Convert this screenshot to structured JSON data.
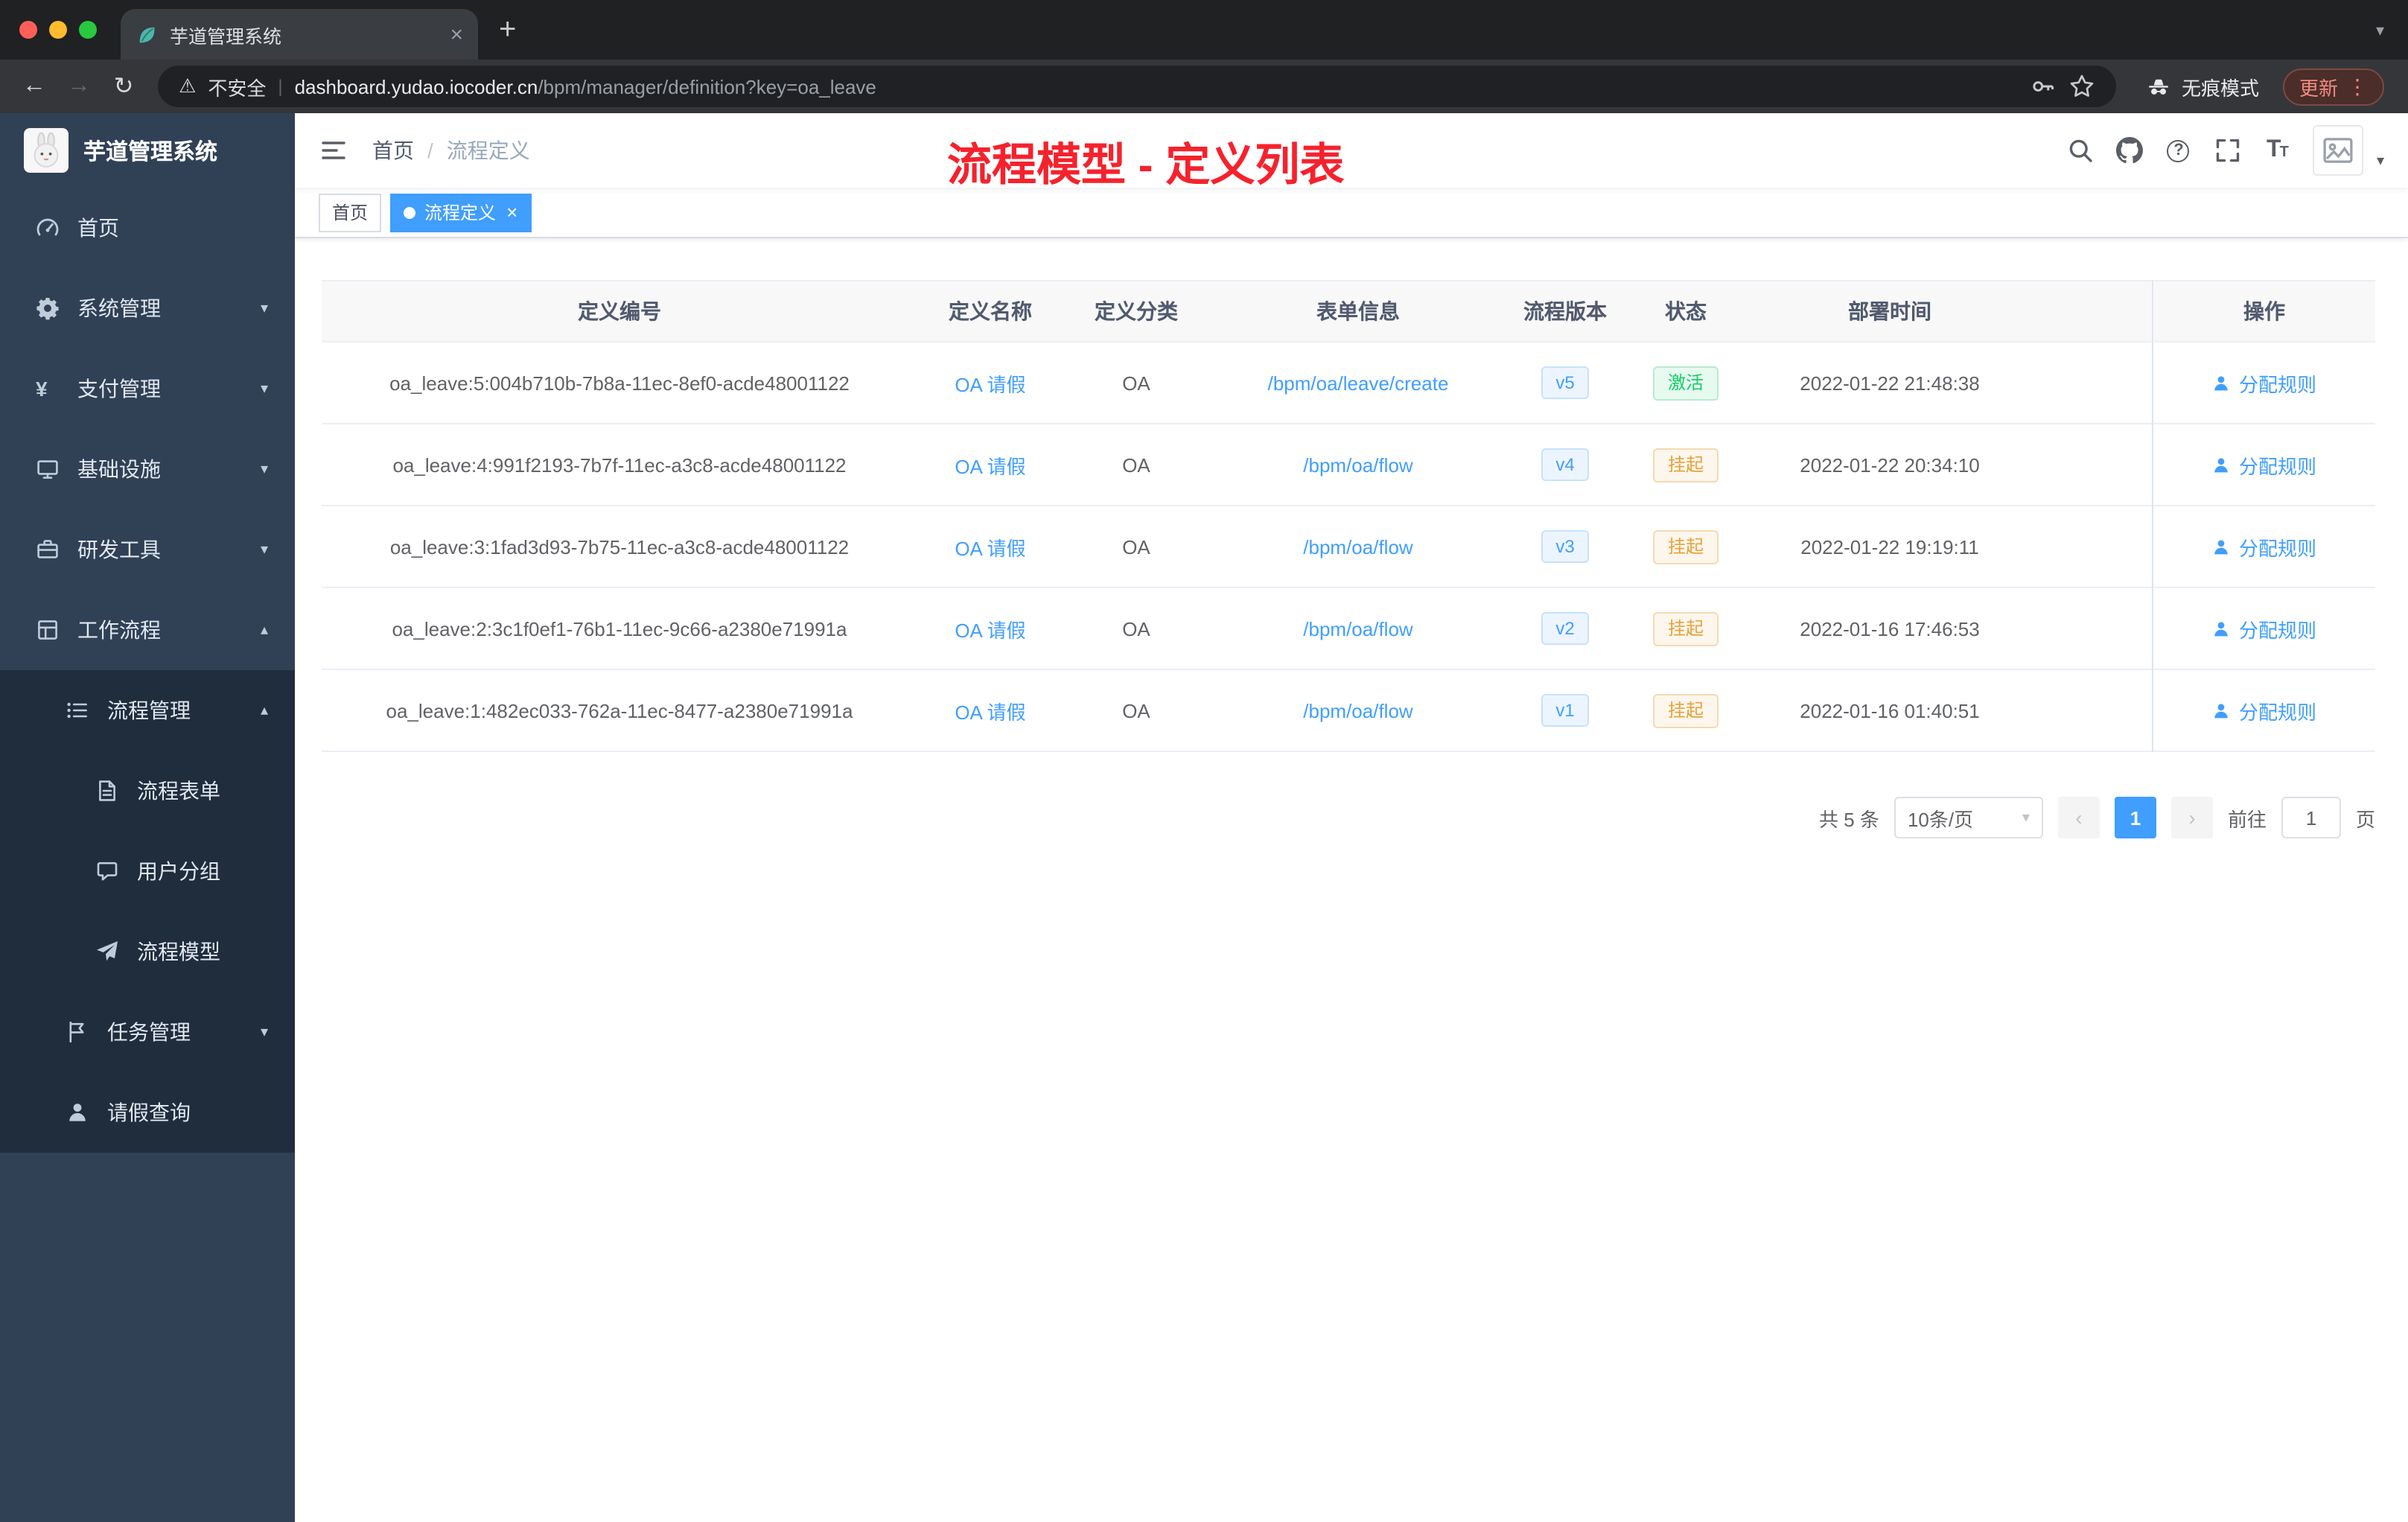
{
  "browser": {
    "tab_title": "芋道管理系统",
    "security_label": "不安全",
    "url_domain": "dashboard.yudao.iocoder.cn",
    "url_path": "/bpm/manager/definition?key=oa_leave",
    "incognito_label": "无痕模式",
    "update_label": "更新"
  },
  "sidebar": {
    "logo_title": "芋道管理系统",
    "menu": [
      {
        "key": "home",
        "label": "首页",
        "icon": "gauge-icon",
        "level": 0,
        "arrow": null,
        "dark": false
      },
      {
        "key": "system-management",
        "label": "系统管理",
        "icon": "gear-icon",
        "level": 0,
        "arrow": "down",
        "dark": false
      },
      {
        "key": "payment-management",
        "label": "支付管理",
        "icon": "yen-icon",
        "level": 0,
        "arrow": "down",
        "dark": false
      },
      {
        "key": "infrastructure",
        "label": "基础设施",
        "icon": "monitor-icon",
        "level": 0,
        "arrow": "down",
        "dark": false
      },
      {
        "key": "dev-tools",
        "label": "研发工具",
        "icon": "toolbox-icon",
        "level": 0,
        "arrow": "down",
        "dark": false
      },
      {
        "key": "workflow",
        "label": "工作流程",
        "icon": "grid-icon",
        "level": 0,
        "arrow": "up",
        "dark": false
      },
      {
        "key": "process-management",
        "label": "流程管理",
        "icon": "list-icon",
        "level": 1,
        "arrow": "up",
        "dark": true
      },
      {
        "key": "process-form",
        "label": "流程表单",
        "icon": "document-icon",
        "level": 2,
        "arrow": null,
        "dark": true
      },
      {
        "key": "user-group",
        "label": "用户分组",
        "icon": "chat-icon",
        "level": 2,
        "arrow": null,
        "dark": true
      },
      {
        "key": "process-model",
        "label": "流程模型",
        "icon": "plane-icon",
        "level": 2,
        "arrow": null,
        "dark": true
      },
      {
        "key": "task-management",
        "label": "任务管理",
        "icon": "flag-icon",
        "level": 1,
        "arrow": "down",
        "dark": true
      },
      {
        "key": "leave-query",
        "label": "请假查询",
        "icon": "person-icon",
        "level": 1,
        "arrow": null,
        "dark": true
      }
    ]
  },
  "header": {
    "breadcrumb": [
      "首页",
      "流程定义"
    ],
    "annotation": "流程模型 - 定义列表"
  },
  "tags": [
    {
      "key": "home",
      "label": "首页",
      "active": false,
      "closable": false
    },
    {
      "key": "process-definition",
      "label": "流程定义",
      "active": true,
      "closable": true
    }
  ],
  "table": {
    "columns": [
      "定义编号",
      "定义名称",
      "定义分类",
      "表单信息",
      "流程版本",
      "状态",
      "部署时间",
      "操作"
    ],
    "rows": [
      {
        "id": "oa_leave:5:004b710b-7b8a-11ec-8ef0-acde48001122",
        "name": "OA 请假",
        "category": "OA",
        "form": "/bpm/oa/leave/create",
        "version": "v5",
        "status": "激活",
        "status_type": "success",
        "deploy_time": "2022-01-22 21:48:38",
        "action": "分配规则"
      },
      {
        "id": "oa_leave:4:991f2193-7b7f-11ec-a3c8-acde48001122",
        "name": "OA 请假",
        "category": "OA",
        "form": "/bpm/oa/flow",
        "version": "v4",
        "status": "挂起",
        "status_type": "warning",
        "deploy_time": "2022-01-22 20:34:10",
        "action": "分配规则"
      },
      {
        "id": "oa_leave:3:1fad3d93-7b75-11ec-a3c8-acde48001122",
        "name": "OA 请假",
        "category": "OA",
        "form": "/bpm/oa/flow",
        "version": "v3",
        "status": "挂起",
        "status_type": "warning",
        "deploy_time": "2022-01-22 19:19:11",
        "action": "分配规则"
      },
      {
        "id": "oa_leave:2:3c1f0ef1-76b1-11ec-9c66-a2380e71991a",
        "name": "OA 请假",
        "category": "OA",
        "form": "/bpm/oa/flow",
        "version": "v2",
        "status": "挂起",
        "status_type": "warning",
        "deploy_time": "2022-01-16 17:46:53",
        "action": "分配规则"
      },
      {
        "id": "oa_leave:1:482ec033-762a-11ec-8477-a2380e71991a",
        "name": "OA 请假",
        "category": "OA",
        "form": "/bpm/oa/flow",
        "version": "v1",
        "status": "挂起",
        "status_type": "warning",
        "deploy_time": "2022-01-16 01:40:51",
        "action": "分配规则"
      }
    ]
  },
  "pagination": {
    "total_label": "共 5 条",
    "page_size": "10条/页",
    "current_page": "1",
    "jump_prefix": "前往",
    "jump_value": "1",
    "jump_suffix": "页"
  },
  "colors": {
    "accent": "#409eff",
    "annotation_red": "#f5222d",
    "sidebar_bg": "#304156",
    "submenu_bg": "#1f2d3d",
    "status_active_green": "#13ce66",
    "status_suspend_orange": "#e6a23c"
  }
}
